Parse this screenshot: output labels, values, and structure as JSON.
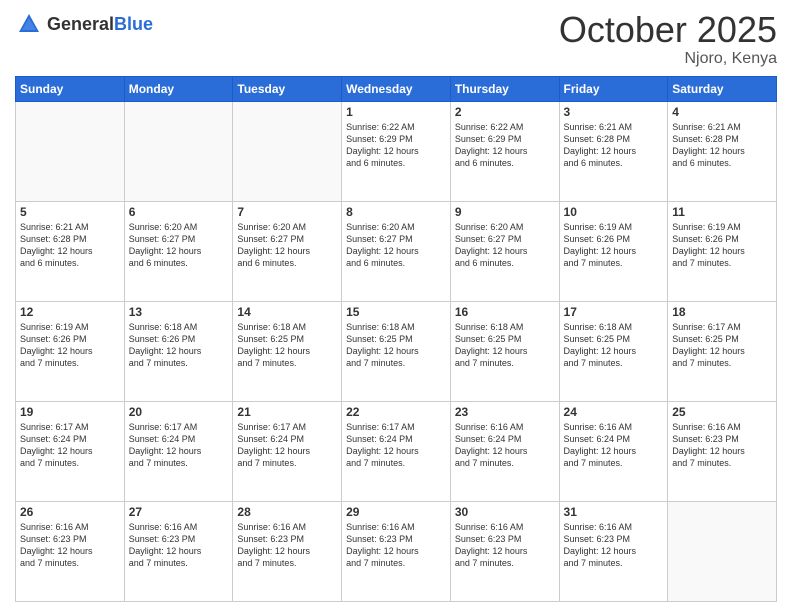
{
  "header": {
    "logo_general": "General",
    "logo_blue": "Blue",
    "month_title": "October 2025",
    "location": "Njoro, Kenya"
  },
  "weekdays": [
    "Sunday",
    "Monday",
    "Tuesday",
    "Wednesday",
    "Thursday",
    "Friday",
    "Saturday"
  ],
  "weeks": [
    [
      {
        "day": "",
        "info": "",
        "empty": true
      },
      {
        "day": "",
        "info": "",
        "empty": true
      },
      {
        "day": "",
        "info": "",
        "empty": true
      },
      {
        "day": "1",
        "info": "Sunrise: 6:22 AM\nSunset: 6:29 PM\nDaylight: 12 hours\nand 6 minutes."
      },
      {
        "day": "2",
        "info": "Sunrise: 6:22 AM\nSunset: 6:29 PM\nDaylight: 12 hours\nand 6 minutes."
      },
      {
        "day": "3",
        "info": "Sunrise: 6:21 AM\nSunset: 6:28 PM\nDaylight: 12 hours\nand 6 minutes."
      },
      {
        "day": "4",
        "info": "Sunrise: 6:21 AM\nSunset: 6:28 PM\nDaylight: 12 hours\nand 6 minutes."
      }
    ],
    [
      {
        "day": "5",
        "info": "Sunrise: 6:21 AM\nSunset: 6:28 PM\nDaylight: 12 hours\nand 6 minutes."
      },
      {
        "day": "6",
        "info": "Sunrise: 6:20 AM\nSunset: 6:27 PM\nDaylight: 12 hours\nand 6 minutes."
      },
      {
        "day": "7",
        "info": "Sunrise: 6:20 AM\nSunset: 6:27 PM\nDaylight: 12 hours\nand 6 minutes."
      },
      {
        "day": "8",
        "info": "Sunrise: 6:20 AM\nSunset: 6:27 PM\nDaylight: 12 hours\nand 6 minutes."
      },
      {
        "day": "9",
        "info": "Sunrise: 6:20 AM\nSunset: 6:27 PM\nDaylight: 12 hours\nand 6 minutes."
      },
      {
        "day": "10",
        "info": "Sunrise: 6:19 AM\nSunset: 6:26 PM\nDaylight: 12 hours\nand 7 minutes."
      },
      {
        "day": "11",
        "info": "Sunrise: 6:19 AM\nSunset: 6:26 PM\nDaylight: 12 hours\nand 7 minutes."
      }
    ],
    [
      {
        "day": "12",
        "info": "Sunrise: 6:19 AM\nSunset: 6:26 PM\nDaylight: 12 hours\nand 7 minutes."
      },
      {
        "day": "13",
        "info": "Sunrise: 6:18 AM\nSunset: 6:26 PM\nDaylight: 12 hours\nand 7 minutes."
      },
      {
        "day": "14",
        "info": "Sunrise: 6:18 AM\nSunset: 6:25 PM\nDaylight: 12 hours\nand 7 minutes."
      },
      {
        "day": "15",
        "info": "Sunrise: 6:18 AM\nSunset: 6:25 PM\nDaylight: 12 hours\nand 7 minutes."
      },
      {
        "day": "16",
        "info": "Sunrise: 6:18 AM\nSunset: 6:25 PM\nDaylight: 12 hours\nand 7 minutes."
      },
      {
        "day": "17",
        "info": "Sunrise: 6:18 AM\nSunset: 6:25 PM\nDaylight: 12 hours\nand 7 minutes."
      },
      {
        "day": "18",
        "info": "Sunrise: 6:17 AM\nSunset: 6:25 PM\nDaylight: 12 hours\nand 7 minutes."
      }
    ],
    [
      {
        "day": "19",
        "info": "Sunrise: 6:17 AM\nSunset: 6:24 PM\nDaylight: 12 hours\nand 7 minutes."
      },
      {
        "day": "20",
        "info": "Sunrise: 6:17 AM\nSunset: 6:24 PM\nDaylight: 12 hours\nand 7 minutes."
      },
      {
        "day": "21",
        "info": "Sunrise: 6:17 AM\nSunset: 6:24 PM\nDaylight: 12 hours\nand 7 minutes."
      },
      {
        "day": "22",
        "info": "Sunrise: 6:17 AM\nSunset: 6:24 PM\nDaylight: 12 hours\nand 7 minutes."
      },
      {
        "day": "23",
        "info": "Sunrise: 6:16 AM\nSunset: 6:24 PM\nDaylight: 12 hours\nand 7 minutes."
      },
      {
        "day": "24",
        "info": "Sunrise: 6:16 AM\nSunset: 6:24 PM\nDaylight: 12 hours\nand 7 minutes."
      },
      {
        "day": "25",
        "info": "Sunrise: 6:16 AM\nSunset: 6:23 PM\nDaylight: 12 hours\nand 7 minutes."
      }
    ],
    [
      {
        "day": "26",
        "info": "Sunrise: 6:16 AM\nSunset: 6:23 PM\nDaylight: 12 hours\nand 7 minutes."
      },
      {
        "day": "27",
        "info": "Sunrise: 6:16 AM\nSunset: 6:23 PM\nDaylight: 12 hours\nand 7 minutes."
      },
      {
        "day": "28",
        "info": "Sunrise: 6:16 AM\nSunset: 6:23 PM\nDaylight: 12 hours\nand 7 minutes."
      },
      {
        "day": "29",
        "info": "Sunrise: 6:16 AM\nSunset: 6:23 PM\nDaylight: 12 hours\nand 7 minutes."
      },
      {
        "day": "30",
        "info": "Sunrise: 6:16 AM\nSunset: 6:23 PM\nDaylight: 12 hours\nand 7 minutes."
      },
      {
        "day": "31",
        "info": "Sunrise: 6:16 AM\nSunset: 6:23 PM\nDaylight: 12 hours\nand 7 minutes."
      },
      {
        "day": "",
        "info": "",
        "empty": true
      }
    ]
  ]
}
